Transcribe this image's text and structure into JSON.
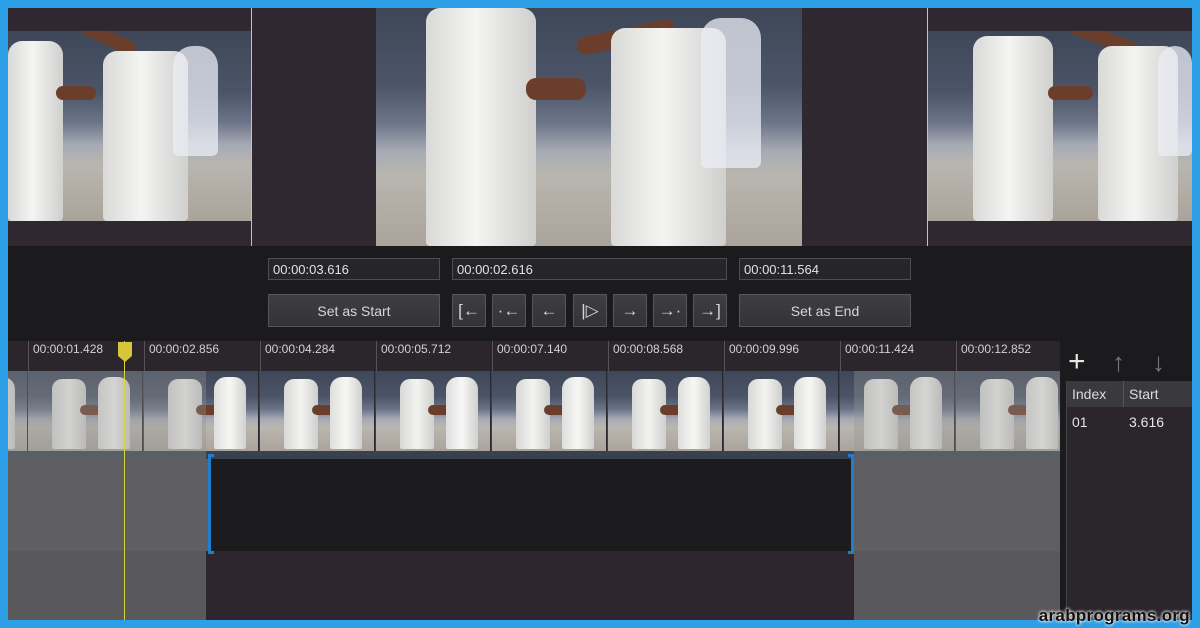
{
  "timecodes": {
    "start": "00:00:03.616",
    "current": "00:00:02.616",
    "end": "00:00:11.564"
  },
  "buttons": {
    "set_start": "Set as Start",
    "set_end": "Set as End",
    "nav": [
      "[←",
      "·←",
      "←",
      "|▷",
      "→",
      "→·",
      "→]"
    ]
  },
  "ruler": {
    "ticks": [
      "00:00:01.428",
      "00:00:02.856",
      "00:00:04.284",
      "00:00:05.712",
      "00:00:07.140",
      "00:00:08.568",
      "00:00:09.996",
      "00:00:11.424",
      "00:00:12.852"
    ]
  },
  "side": {
    "icons": [
      "plus-icon",
      "arrow-up-icon",
      "arrow-down-icon"
    ],
    "columns": [
      "Index",
      "Start"
    ],
    "rows": [
      [
        "01",
        "3.616"
      ]
    ]
  },
  "watermark": "arabprograms.org",
  "colors": {
    "accent": "#1f7fce",
    "playhead": "#d8d23a",
    "background": "#1b1b1d"
  }
}
